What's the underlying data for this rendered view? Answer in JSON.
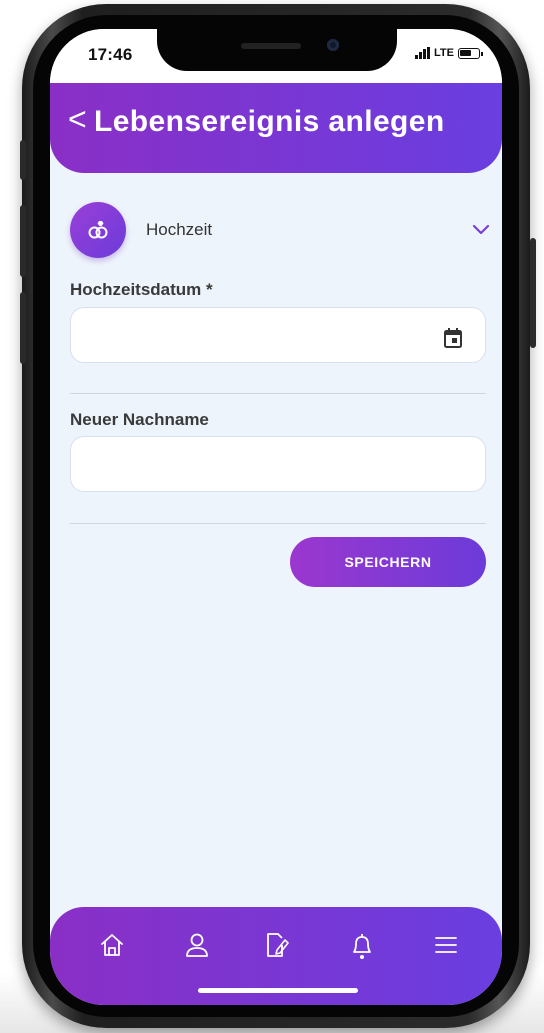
{
  "status_bar": {
    "time": "17:46",
    "network": "LTE"
  },
  "header": {
    "back_glyph": "<",
    "title": "Lebensereignis anlegen"
  },
  "event": {
    "icon": "rings-icon",
    "label": "Hochzeit",
    "dropdown_icon": "chevron-down-icon"
  },
  "form": {
    "wedding_date": {
      "label": "Hochzeitsdatum *",
      "value": "",
      "placeholder": "",
      "icon": "calendar-icon"
    },
    "new_surname": {
      "label": "Neuer Nachname",
      "value": "",
      "placeholder": ""
    },
    "save_label": "SPEICHERN"
  },
  "bottom_nav": [
    {
      "icon": "home-icon"
    },
    {
      "icon": "user-icon"
    },
    {
      "icon": "edit-document-icon"
    },
    {
      "icon": "bell-icon"
    },
    {
      "icon": "menu-icon"
    }
  ],
  "colors": {
    "accent_start": "#8a2fc6",
    "accent_end": "#6a3ee0",
    "background": "#eef4fb"
  }
}
